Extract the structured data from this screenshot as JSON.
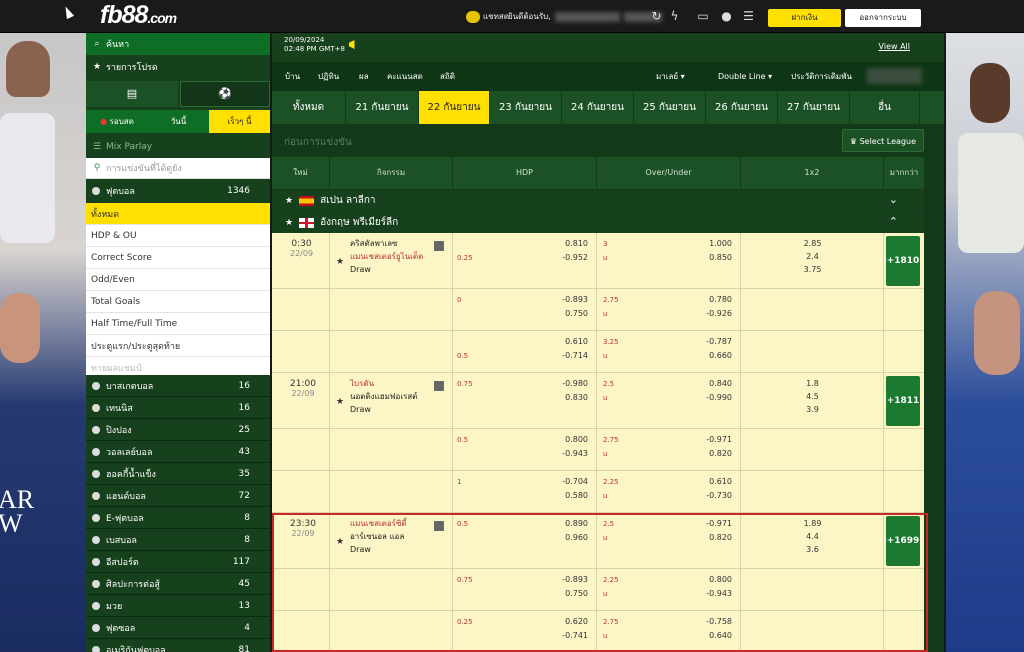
{
  "header": {
    "logo": "fb88",
    "logo_domain": ".com",
    "chat_label": "แชทสด",
    "welcome": "ยินดีต้อนรับ,",
    "deposit_label": "ฝากเงิน",
    "logout_label": "ออกจากระบบ"
  },
  "sidebar": {
    "search": "ค้นหา",
    "favorites": "รายการโปรด",
    "tabs2": [
      "วันนี้",
      "เร็วๆ นี้"
    ],
    "live_label": "รอบสด",
    "mix_parlay": "Mix Parlay",
    "filter_placeholder": "การแข่งขันที่ได้ดูยัง",
    "football": {
      "name": "ฟุตบอล",
      "count": "1346"
    },
    "football_sub": [
      {
        "label": "ทั้งหมด",
        "active": true
      },
      {
        "label": "HDP & OU"
      },
      {
        "label": "Correct Score"
      },
      {
        "label": "Odd/Even"
      },
      {
        "label": "Total Goals"
      },
      {
        "label": "Half Time/Full Time"
      },
      {
        "label": "ประตูแรก/ประตูสุดท้าย"
      },
      {
        "label": "ทายผลแชมป์",
        "disabled": true
      }
    ],
    "sports": [
      {
        "name": "บาสเกตบอล",
        "count": "16"
      },
      {
        "name": "เทนนิส",
        "count": "16"
      },
      {
        "name": "ปิงปอง",
        "count": "25"
      },
      {
        "name": "วอลเลย์บอล",
        "count": "43"
      },
      {
        "name": "ฮอคกี้น้ำแข็ง",
        "count": "35"
      },
      {
        "name": "แฮนด์บอล",
        "count": "72"
      },
      {
        "name": "E-ฟุตบอล",
        "count": "8"
      },
      {
        "name": "เบสบอล",
        "count": "8"
      },
      {
        "name": "อีสปอร์ต",
        "count": "117"
      },
      {
        "name": "ศิลปะการต่อสู้",
        "count": "45"
      },
      {
        "name": "มวย",
        "count": "13"
      },
      {
        "name": "ฟุตซอล",
        "count": "4"
      },
      {
        "name": "อเมริกันฟุตบอล",
        "count": "81"
      }
    ]
  },
  "topinfo": {
    "date": "20/09/2024",
    "time": "02:48 PM GMT+8",
    "view_all": "View All"
  },
  "nav": {
    "left": [
      "บ้าน",
      "ปฏิทิน",
      "ผล",
      "คะแนนสด",
      "สถิติ"
    ],
    "right": [
      "มาเลย์",
      "Double Line",
      "ประวัติการเดิมพัน"
    ]
  },
  "dates": [
    "ทั้งหมด",
    "21 กันยายน",
    "22 กันยายน",
    "23 กันยายน",
    "24 กันยายน",
    "25 กันยายน",
    "26 กันยายน",
    "27 กันยายน",
    "อื่น"
  ],
  "active_date": 2,
  "comp_title": "ก่อนการแข่งขัน",
  "select_league": "Select League",
  "table_headers": [
    "ใหม่",
    "กิจกรรม",
    "HDP",
    "Over/Under",
    "1x2",
    "มากกว่า"
  ],
  "leagues": [
    "สเปน ลาลีกา",
    "อังกฤษ พรีเมียร์ลีก"
  ],
  "matches": [
    {
      "time": "0:30",
      "date": "22/09",
      "team1": "คริสตัลพาเลซ",
      "team2": "แมนเชสเตอร์ยูไนเต็ด",
      "draw": "Draw",
      "team1_red": false,
      "more": "+1810",
      "x12": [
        "2.85",
        "2.4",
        "3.75"
      ],
      "lines": [
        {
          "hdp": "",
          "h1": "0.810",
          "h2": "-0.952",
          "hline2": "0.25",
          "ou": "3",
          "ou2": "u",
          "o1": "1.000",
          "o2": "0.850"
        },
        {
          "hdp": "0",
          "h1": "-0.893",
          "h2": "0.750",
          "hline2": "",
          "ou": "2.75",
          "ou2": "u",
          "o1": "0.780",
          "o2": "-0.926"
        },
        {
          "hdp": "",
          "h1": "0.610",
          "h2": "-0.714",
          "hline2": "0.5",
          "ou": "3.25",
          "ou2": "u",
          "o1": "-0.787",
          "o2": "0.660"
        }
      ]
    },
    {
      "time": "21:00",
      "date": "22/09",
      "team1": "ไบรตัน",
      "team2": "นอตติงแฮมฟอเรสต์",
      "draw": "Draw",
      "team1_red": true,
      "more": "+1811",
      "x12": [
        "1.8",
        "4.5",
        "3.9"
      ],
      "lines": [
        {
          "hdp": "0.75",
          "h1": "-0.980",
          "h2": "0.830",
          "hline2": "",
          "ou": "2.5",
          "ou2": "u",
          "o1": "0.840",
          "o2": "-0.990"
        },
        {
          "hdp": "0.5",
          "h1": "0.800",
          "h2": "-0.943",
          "hline2": "",
          "ou": "2.75",
          "ou2": "u",
          "o1": "-0.971",
          "o2": "0.820"
        },
        {
          "hdp": "1",
          "h1": "-0.704",
          "h2": "0.580",
          "hline2": "",
          "ou": "2.25",
          "ou2": "u",
          "o1": "0.610",
          "o2": "-0.730"
        }
      ]
    },
    {
      "time": "23:30",
      "date": "22/09",
      "team1": "แมนเชสเตอร์ซิตี้",
      "team2": "อาร์เซนอล แอล",
      "draw": "Draw",
      "team1_red": true,
      "more": "+1699",
      "x12": [
        "1.89",
        "4.4",
        "3.6"
      ],
      "lines": [
        {
          "hdp": "0.5",
          "h1": "0.890",
          "h2": "0.960",
          "hline2": "",
          "ou": "2.5",
          "ou2": "u",
          "o1": "-0.971",
          "o2": "0.820"
        },
        {
          "hdp": "0.75",
          "h1": "-0.893",
          "h2": "0.750",
          "hline2": "",
          "ou": "2.25",
          "ou2": "u",
          "o1": "0.800",
          "o2": "-0.943"
        },
        {
          "hdp": "0.25",
          "h1": "0.620",
          "h2": "-0.741",
          "hline2": "",
          "ou": "2.75",
          "ou2": "u",
          "o1": "-0.758",
          "o2": "0.640"
        }
      ]
    }
  ]
}
